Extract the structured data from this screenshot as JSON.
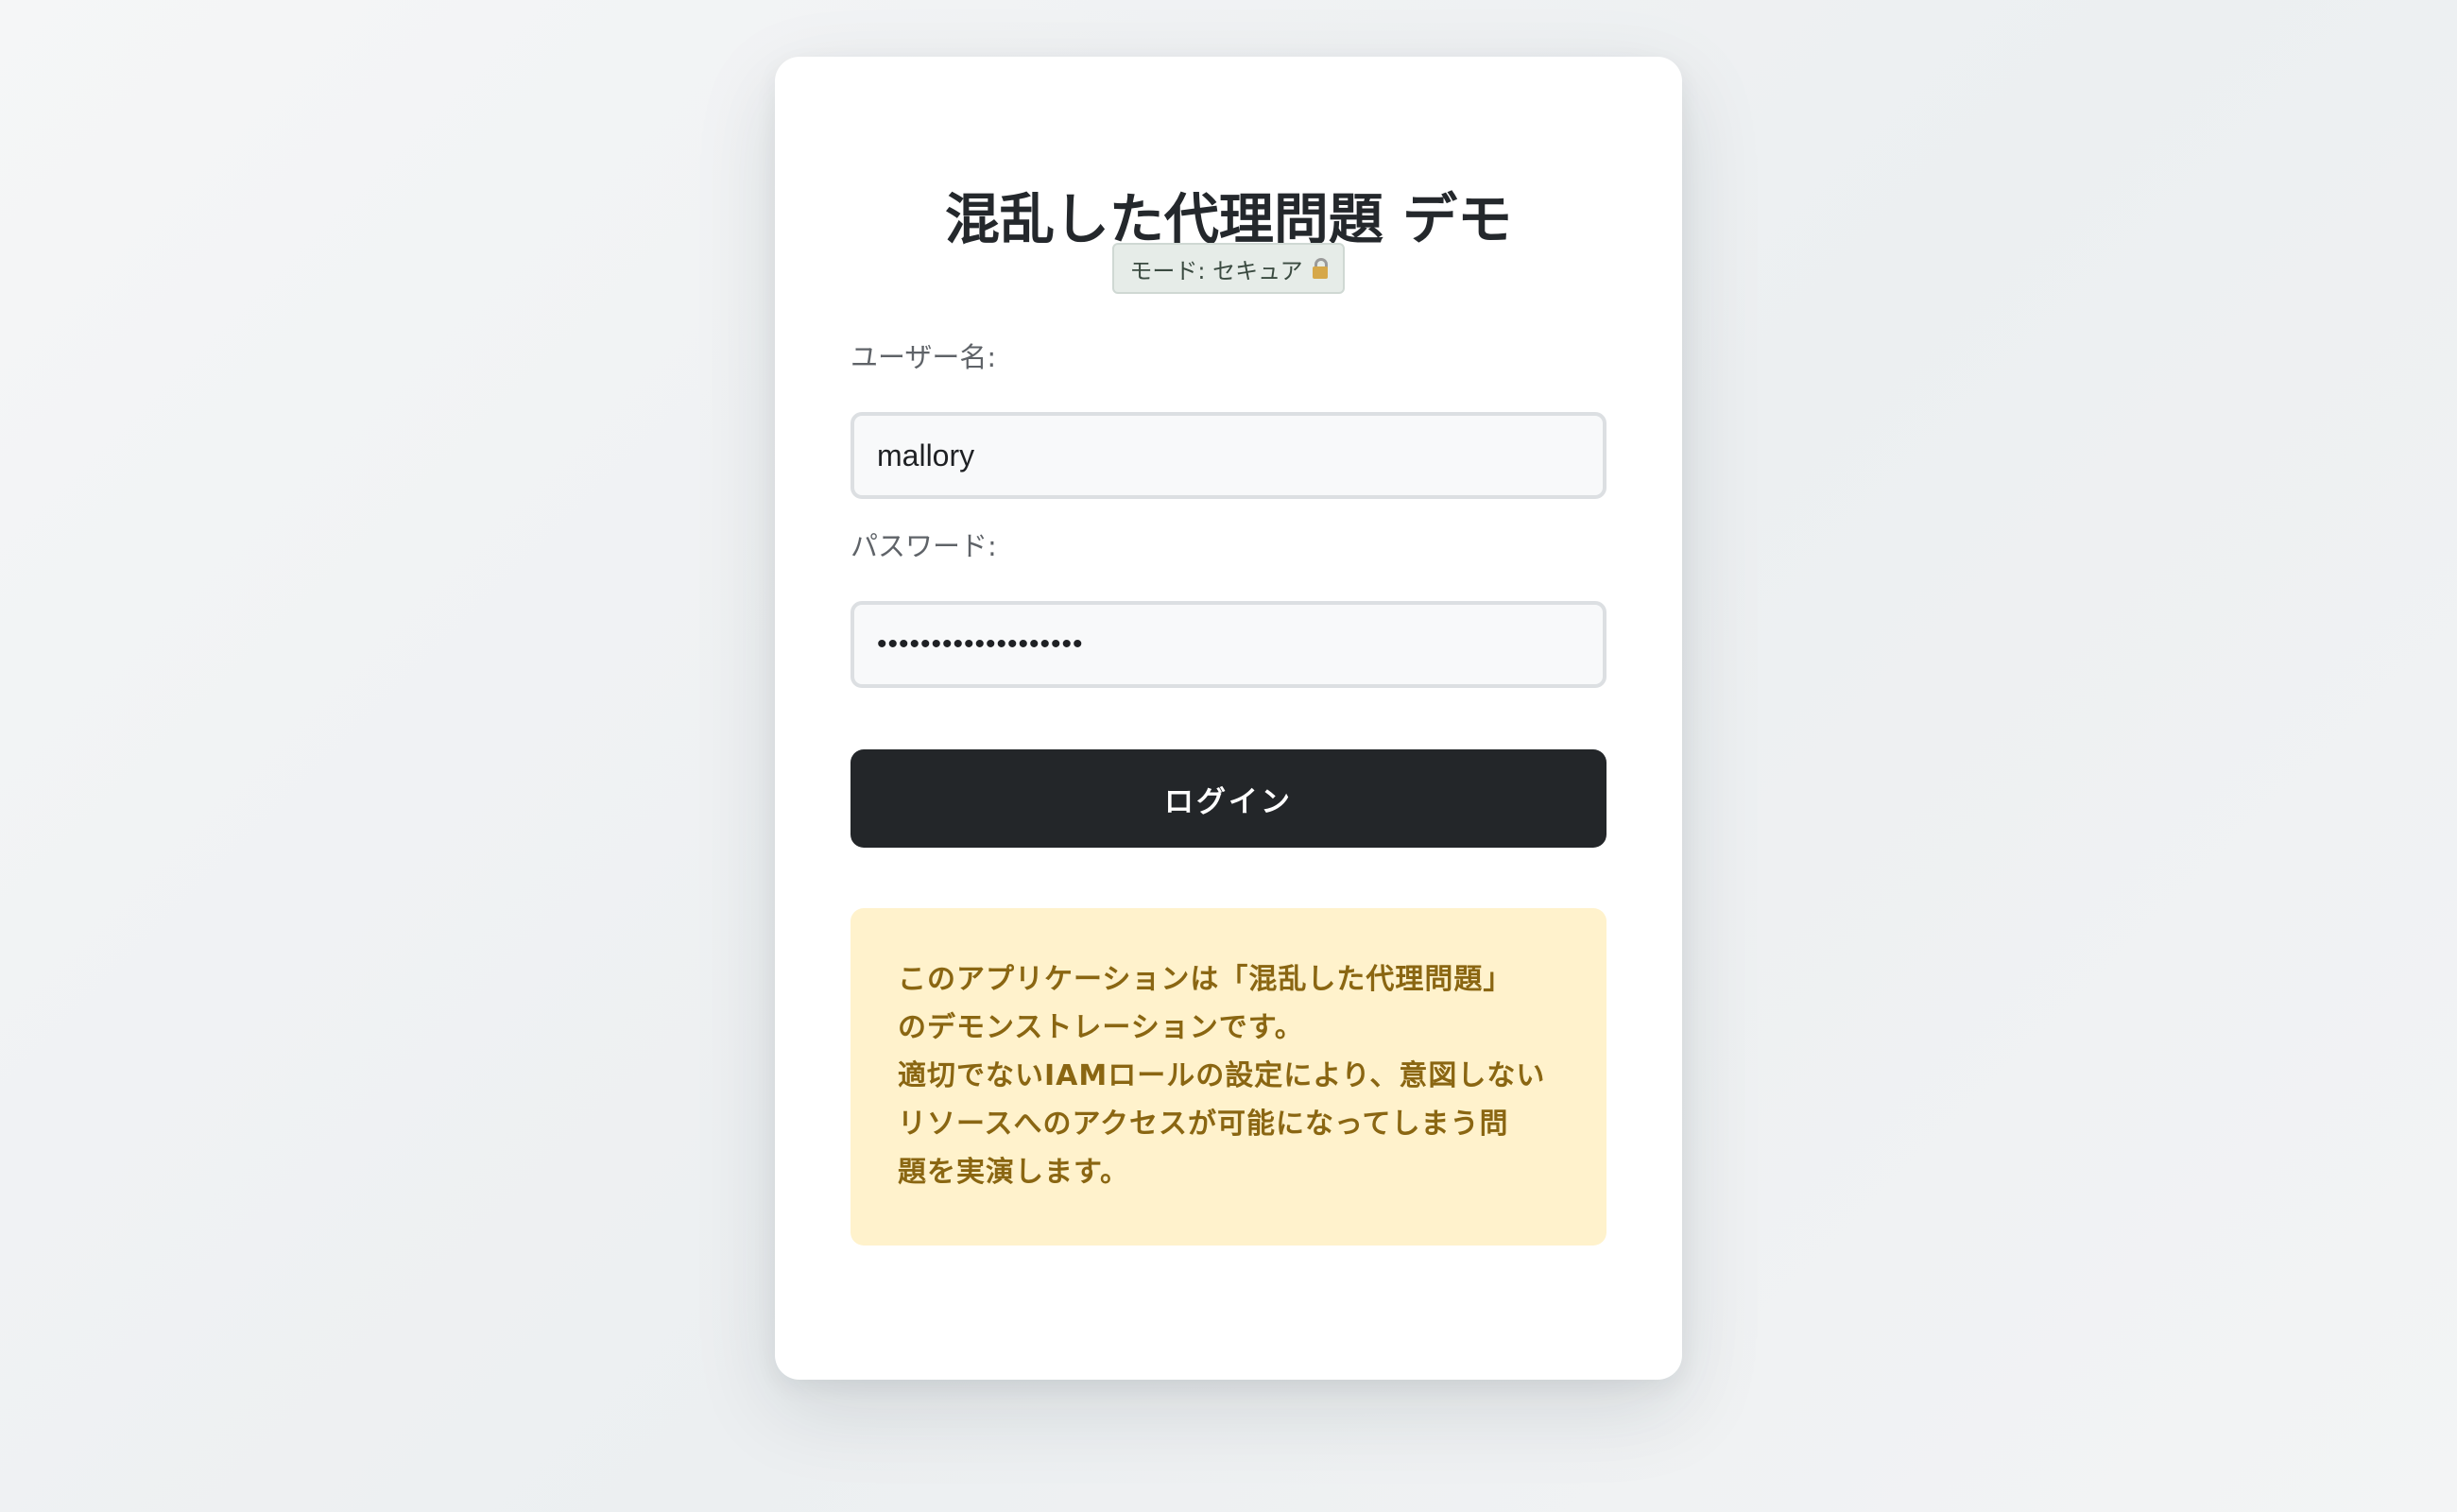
{
  "header": {
    "title": "混乱した代理問題 デモ",
    "mode_badge": "モード: セキュア"
  },
  "icons": {
    "mode_badge_icon": "lock-icon"
  },
  "form": {
    "username_label": "ユーザー名:",
    "username_value": "mallory",
    "password_label": "パスワード:",
    "password_value": "•••••••••••••••••••",
    "login_button": "ログイン"
  },
  "info": {
    "lines": [
      "このアプリケーションは「混乱した代理問題」",
      "のデモンストレーションです。",
      "適切でないIAMロールの設定により、意図しない",
      "リソースへのアクセスが可能になってしまう問",
      "題を実演します。"
    ]
  },
  "colors": {
    "primary_button": "#232629",
    "info_background": "#fff2cc",
    "info_text": "#8a6612",
    "mode_badge_background": "#e6ece8"
  }
}
